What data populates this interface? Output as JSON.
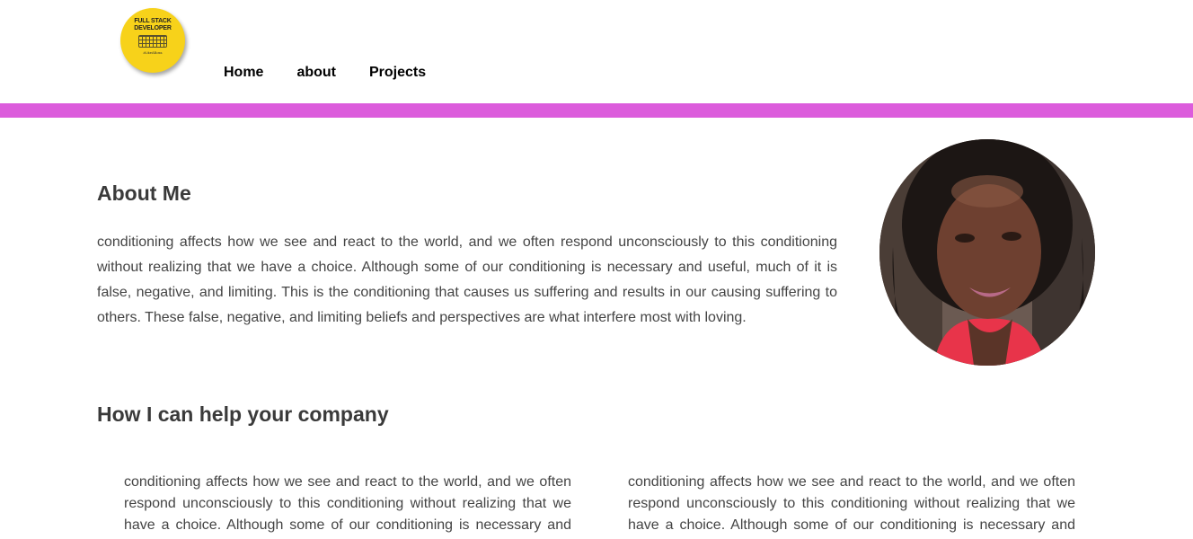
{
  "logo": {
    "line1": "FULL STACK",
    "line2": "DEVELOPER",
    "small": "#LikeABoss",
    "color": "#f7d21a"
  },
  "nav": {
    "items": [
      {
        "label": "Home"
      },
      {
        "label": "about"
      },
      {
        "label": "Projects"
      }
    ]
  },
  "accent_color": "#dc5cdc",
  "about": {
    "title": "About Me",
    "text": "conditioning affects how we see and react to the world, and we often respond unconsciously to this conditioning without realizing that we have a choice. Although some of our conditioning is necessary and useful, much of it is false, negative, and limiting. This is the conditioning that causes us suffering and results in our causing suffering to others. These false, negative, and limiting beliefs and perspectives are what interfere most with loving."
  },
  "help": {
    "title": "How I can help your company",
    "columns": [
      {
        "text": "conditioning affects how we see and react to the world, and we often respond unconsciously to this conditioning without realizing that we have a choice. Although some of our conditioning is necessary and useful, much of it is false, negative, and limiting."
      },
      {
        "text": "conditioning affects how we see and react to the world, and we often respond unconsciously to this conditioning without realizing that we have a choice. Although some of our conditioning is necessary and useful, much of it is false, negative, and limiting."
      }
    ]
  }
}
